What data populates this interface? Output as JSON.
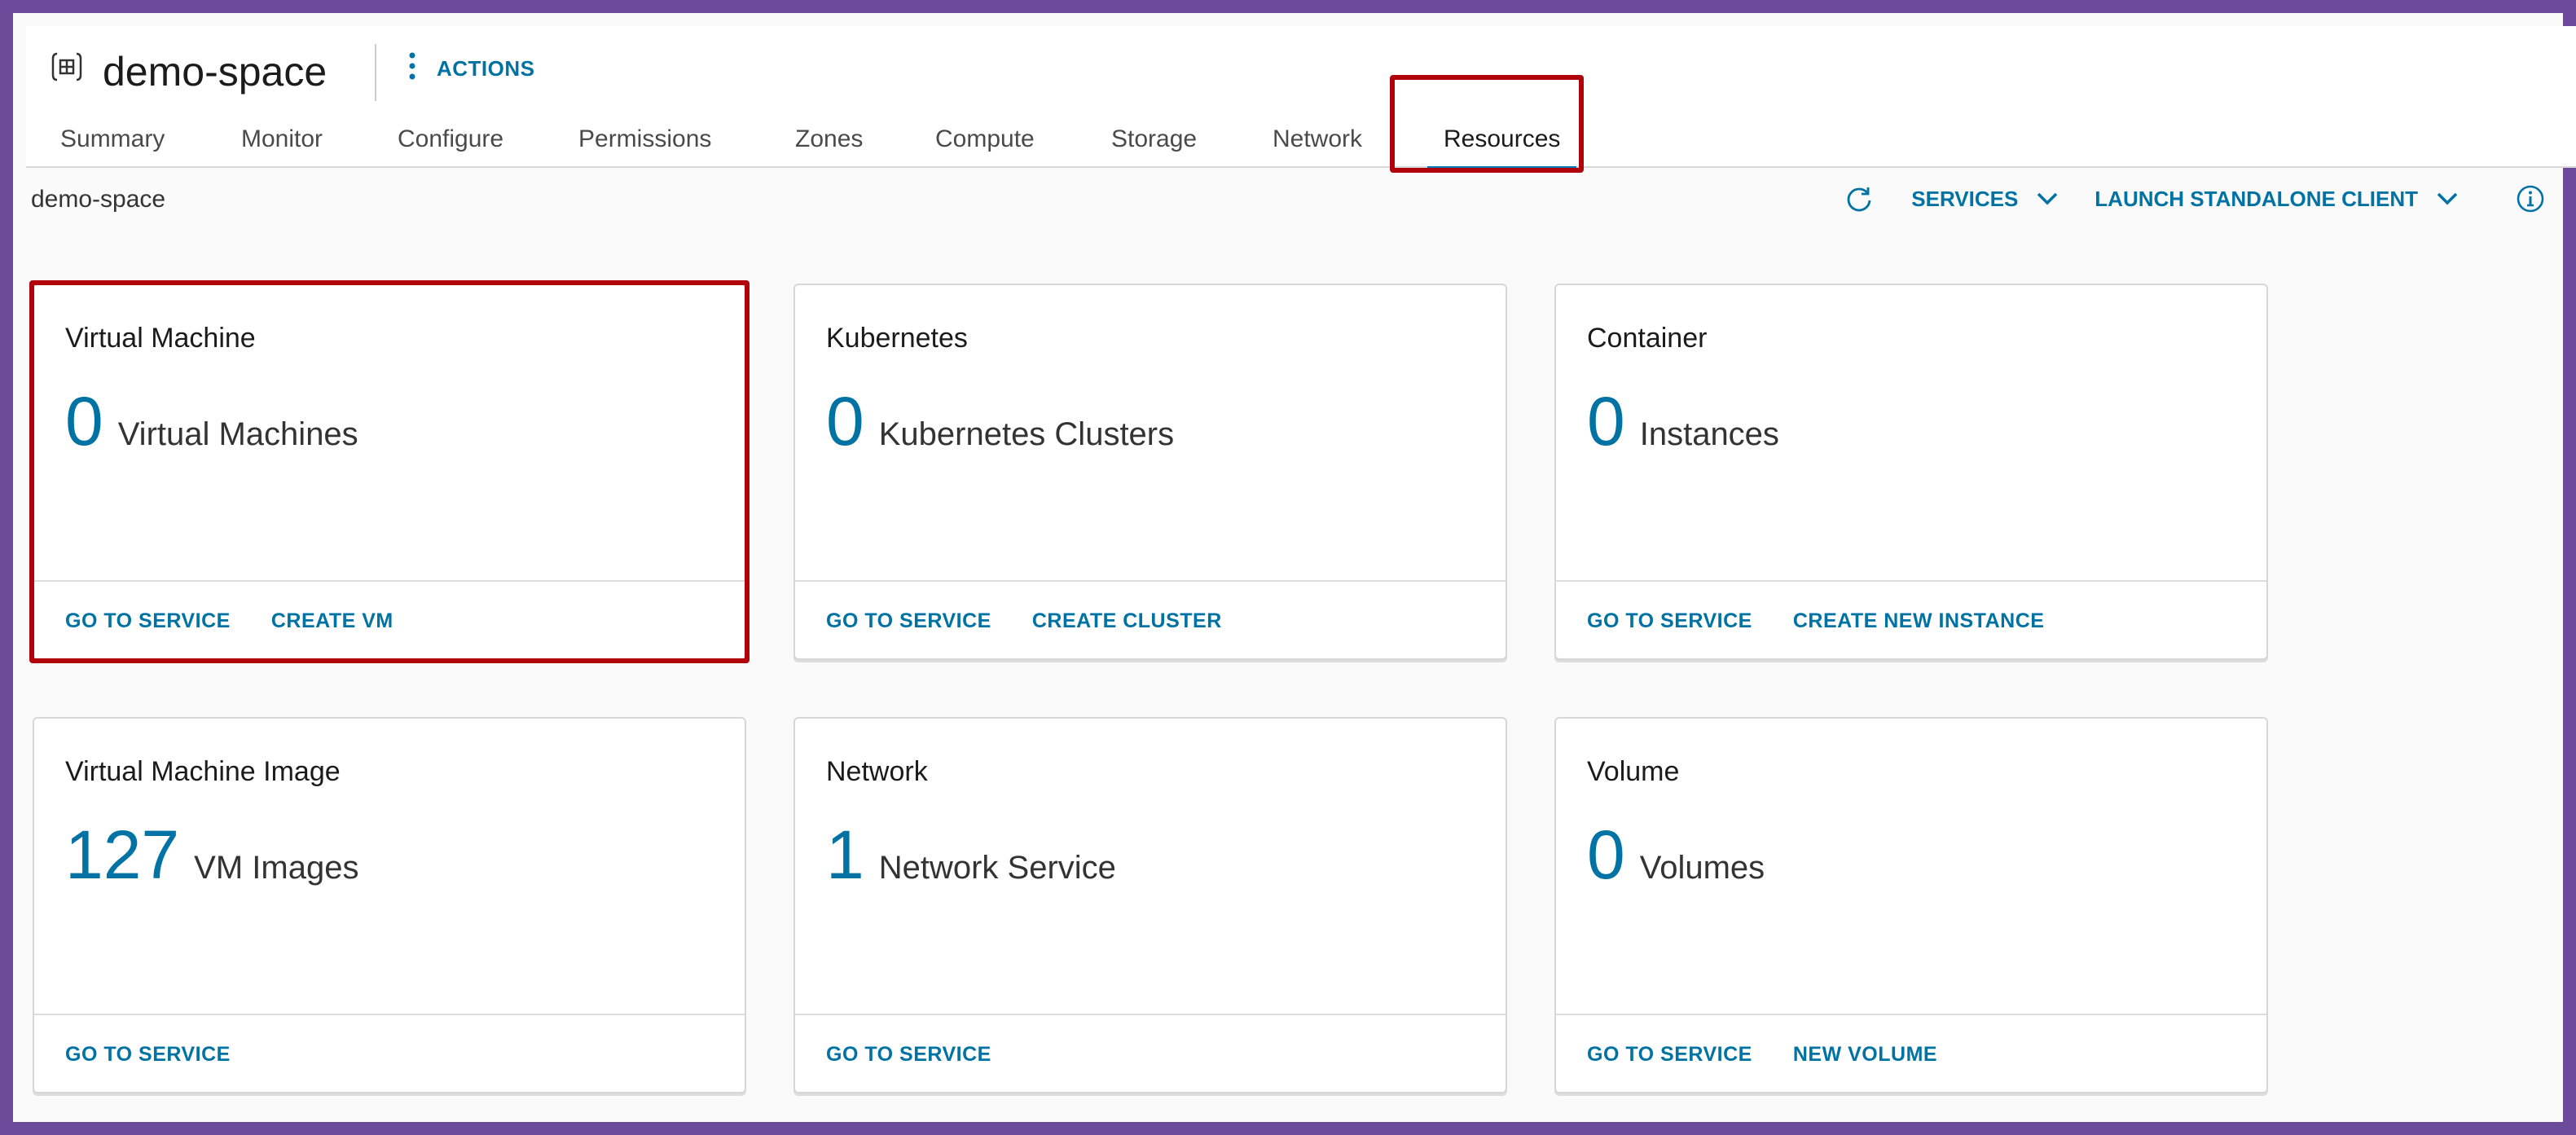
{
  "header": {
    "title": "demo-space",
    "actions_label": "ACTIONS"
  },
  "tabs": [
    {
      "label": "Summary"
    },
    {
      "label": "Monitor"
    },
    {
      "label": "Configure"
    },
    {
      "label": "Permissions"
    },
    {
      "label": "Zones"
    },
    {
      "label": "Compute"
    },
    {
      "label": "Storage"
    },
    {
      "label": "Network"
    },
    {
      "label": "Resources",
      "active": true
    }
  ],
  "toolbar": {
    "breadcrumb": "demo-space",
    "services_label": "SERVICES",
    "launch_label": "LAUNCH STANDALONE CLIENT",
    "icons": [
      "refresh-icon",
      "chevron-down-icon",
      "info-icon"
    ]
  },
  "cards": [
    {
      "title": "Virtual Machine",
      "count": "0",
      "unit": "Virtual Machines",
      "links": [
        "GO TO SERVICE",
        "CREATE VM"
      ],
      "highlighted": true
    },
    {
      "title": "Kubernetes",
      "count": "0",
      "unit": "Kubernetes Clusters",
      "links": [
        "GO TO SERVICE",
        "CREATE CLUSTER"
      ]
    },
    {
      "title": "Container",
      "count": "0",
      "unit": "Instances",
      "links": [
        "GO TO SERVICE",
        "CREATE NEW INSTANCE"
      ]
    },
    {
      "title": "Virtual Machine Image",
      "count": "127",
      "unit": "VM Images",
      "links": [
        "GO TO SERVICE"
      ]
    },
    {
      "title": "Network",
      "count": "1",
      "unit": "Network Service",
      "links": [
        "GO TO SERVICE"
      ]
    },
    {
      "title": "Volume",
      "count": "0",
      "unit": "Volumes",
      "links": [
        "GO TO SERVICE",
        "NEW VOLUME"
      ]
    }
  ],
  "colors": {
    "accent": "#0072a3",
    "tab_underline": "#0079b8",
    "highlight": "#b0030b",
    "frame": "#6b4b99"
  }
}
